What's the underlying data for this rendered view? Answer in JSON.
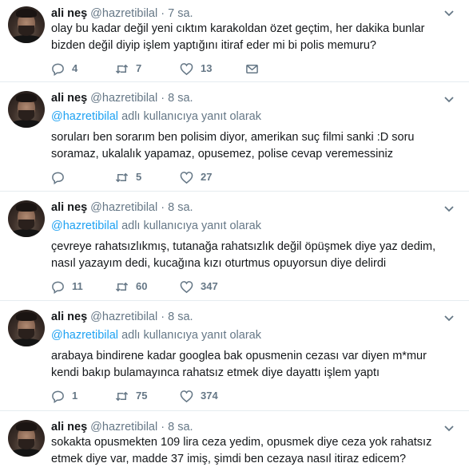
{
  "tweets": [
    {
      "name": "ali neş",
      "handle": "@hazretibilal",
      "dot": "·",
      "time": "7 sa.",
      "reply_mention": "",
      "reply_suffix": "",
      "text": "olay bu kadar değil yeni cıktım karakoldan özet geçtim, her dakika bunlar bizden değil diyip işlem yaptığını itiraf eder mi bi polis memuru?",
      "replies": "4",
      "retweets": "7",
      "likes": "13"
    },
    {
      "name": "ali neş",
      "handle": "@hazretibilal",
      "dot": "·",
      "time": "8 sa.",
      "reply_mention": "@hazretibilal",
      "reply_suffix": " adlı kullanıcıya yanıt olarak",
      "text": "soruları ben sorarım ben polisim diyor, amerikan suç filmi sanki :D soru  soramaz, ukalalık yapamaz, opusemez, polise cevap veremessiniz",
      "replies": "",
      "retweets": "5",
      "likes": "27"
    },
    {
      "name": "ali neş",
      "handle": "@hazretibilal",
      "dot": "·",
      "time": "8 sa.",
      "reply_mention": "@hazretibilal",
      "reply_suffix": " adlı kullanıcıya yanıt olarak",
      "text": "çevreye rahatsızlıkmış, tutanağa rahatsızlık değil öpüşmek diye yaz dedim, nasıl yazayım dedi, kucağına kızı oturtmus opuyorsun diye delirdi",
      "replies": "11",
      "retweets": "60",
      "likes": "347"
    },
    {
      "name": "ali neş",
      "handle": "@hazretibilal",
      "dot": "·",
      "time": "8 sa.",
      "reply_mention": "@hazretibilal",
      "reply_suffix": " adlı kullanıcıya yanıt olarak",
      "text": "arabaya bindirene kadar googlea bak opusmenin cezası var diyen m*mur kendi bakıp bulamayınca rahatsız etmek diye dayattı işlem yaptı",
      "replies": "1",
      "retweets": "75",
      "likes": "374"
    },
    {
      "name": "ali neş",
      "handle": "@hazretibilal",
      "dot": "·",
      "time": "8 sa.",
      "reply_mention": "",
      "reply_suffix": "",
      "text": "sokakta opusmekten 109 lira ceza yedim, opusmek diye ceza yok rahatsız etmek diye var, madde 37 imiş, şimdi ben cezaya nasıl itiraz edicem?",
      "replies": "",
      "retweets": "",
      "likes": ""
    }
  ],
  "icons": {
    "reply": "reply-icon",
    "retweet": "retweet-icon",
    "like": "heart-icon",
    "dm": "envelope-icon",
    "more": "chevron-down-icon"
  },
  "colors": {
    "text": "#14171a",
    "muted": "#657786",
    "link": "#1da1f2",
    "divider": "#e6ecf0"
  }
}
